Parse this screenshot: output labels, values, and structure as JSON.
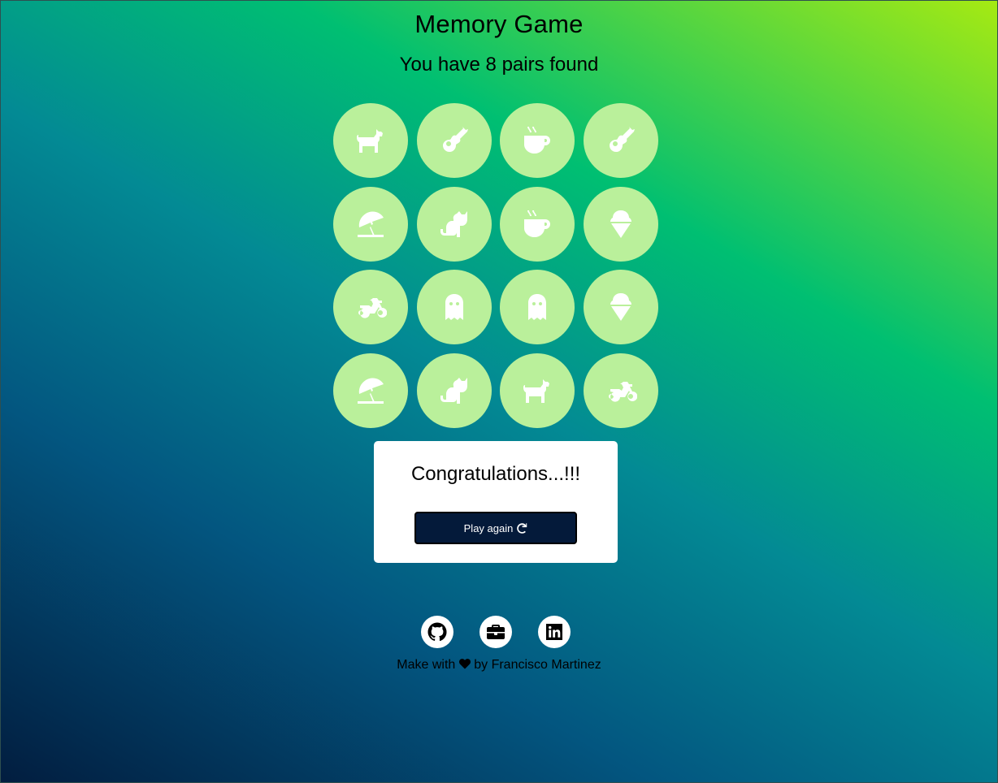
{
  "header": {
    "title": "Memory Game",
    "subtitle": "You have 8 pairs found"
  },
  "board": {
    "card_color": "#baf09b",
    "cards": [
      {
        "icon": "dog-icon"
      },
      {
        "icon": "guitar-icon"
      },
      {
        "icon": "mug-hot-icon"
      },
      {
        "icon": "guitar-icon"
      },
      {
        "icon": "umbrella-beach-icon"
      },
      {
        "icon": "cat-icon"
      },
      {
        "icon": "mug-hot-icon"
      },
      {
        "icon": "ice-cream-icon"
      },
      {
        "icon": "motorcycle-icon"
      },
      {
        "icon": "ghost-icon"
      },
      {
        "icon": "ghost-icon"
      },
      {
        "icon": "ice-cream-icon"
      },
      {
        "icon": "umbrella-beach-icon"
      },
      {
        "icon": "cat-icon"
      },
      {
        "icon": "dog-icon"
      },
      {
        "icon": "motorcycle-icon"
      }
    ]
  },
  "modal": {
    "message": "Congratulations...!!!",
    "button_label": "Play again",
    "button_icon": "redo-icon"
  },
  "social": [
    {
      "icon": "github-icon"
    },
    {
      "icon": "briefcase-icon"
    },
    {
      "icon": "linkedin-icon"
    }
  ],
  "footer": {
    "prefix": "Make with",
    "heart_icon": "heart-icon",
    "suffix": "by Francisco Martinez"
  }
}
